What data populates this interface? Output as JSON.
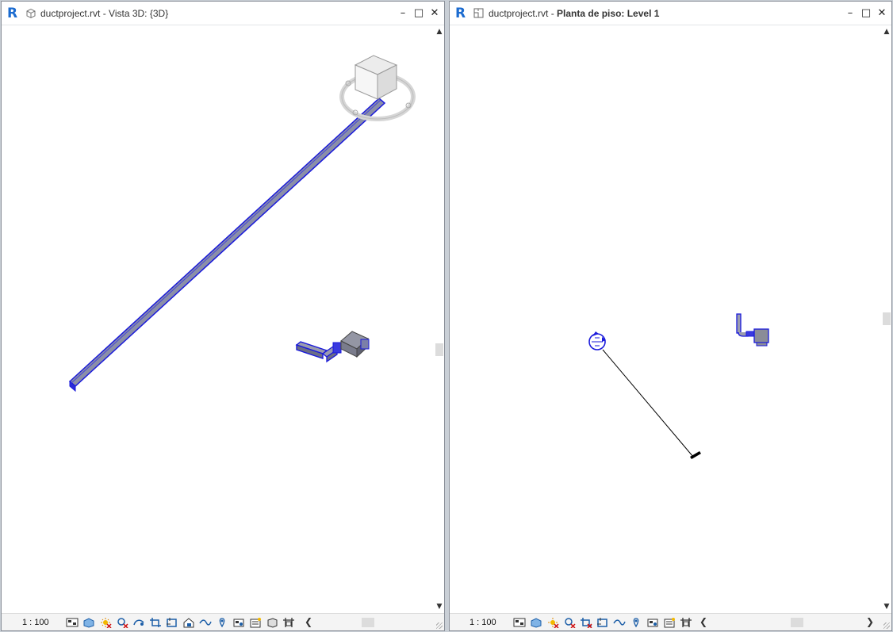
{
  "left_view": {
    "title_file": "ductproject.rvt",
    "title_sep": " - ",
    "title_view": "Vista 3D: {3D}",
    "scale": "1 : 100",
    "view_icon": "3d-view-icon"
  },
  "right_view": {
    "title_file": "ductproject.rvt",
    "title_sep": " - ",
    "title_view": "Planta de piso: Level 1",
    "scale": "1 : 100",
    "view_icon": "floor-plan-icon"
  },
  "window_controls": {
    "minimize": "–",
    "maximize": "□",
    "close": "✕"
  },
  "scroll": {
    "up": "▲",
    "down": "▼",
    "left": "❮",
    "right": "❯"
  },
  "app_logo": "R",
  "colors": {
    "duct_blue": "#1a1adb",
    "duct_fill": "#8b8fa8",
    "revit_blue": "#1b6bd0"
  },
  "view_control_icons": [
    "detail-level-icon",
    "visual-style-icon",
    "sun-path-icon",
    "shadows-icon",
    "show-rendering-icon",
    "crop-view-icon",
    "show-crop-region-icon",
    "unlock-3d-view-icon",
    "temporary-hide-icon",
    "reveal-hidden-icon",
    "temporary-view-properties-icon",
    "worksharing-display-icon",
    "analytical-model-icon"
  ]
}
